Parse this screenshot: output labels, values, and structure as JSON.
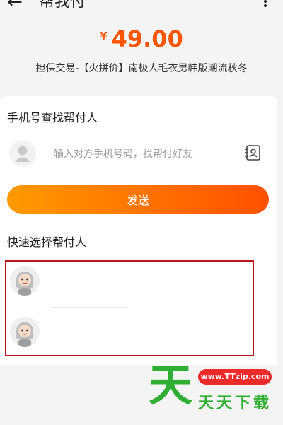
{
  "header": {
    "back_icon": "arrow-left-icon",
    "title": "帮我付",
    "more_icon": "more-vertical-icon"
  },
  "order": {
    "currency": "¥",
    "amount": "49.00",
    "description": "担保交易-【火拼价】南极人毛衣男韩版潮流秋冬"
  },
  "phone_search": {
    "title": "手机号查找帮付人",
    "placeholder": "输入对方手机号码，找帮付好友",
    "avatar_icon": "user-placeholder-icon",
    "contact_icon": "contact-book-icon"
  },
  "send_button": {
    "label": "发送",
    "color_start": "#ff9a00",
    "color_end": "#ff5000"
  },
  "quick_select": {
    "title": "快速选择帮付人",
    "helpers": [
      {
        "avatar_icon": "cartoon-avatar-icon"
      },
      {
        "avatar_icon": "cartoon-avatar-icon"
      }
    ],
    "highlight_color": "#c1121f"
  },
  "watermark": {
    "glyph": "天",
    "url": "www.TTzip.com",
    "text": "天天下载"
  },
  "colors": {
    "accent": "#ff5500",
    "brand_green": "#2fae33"
  }
}
